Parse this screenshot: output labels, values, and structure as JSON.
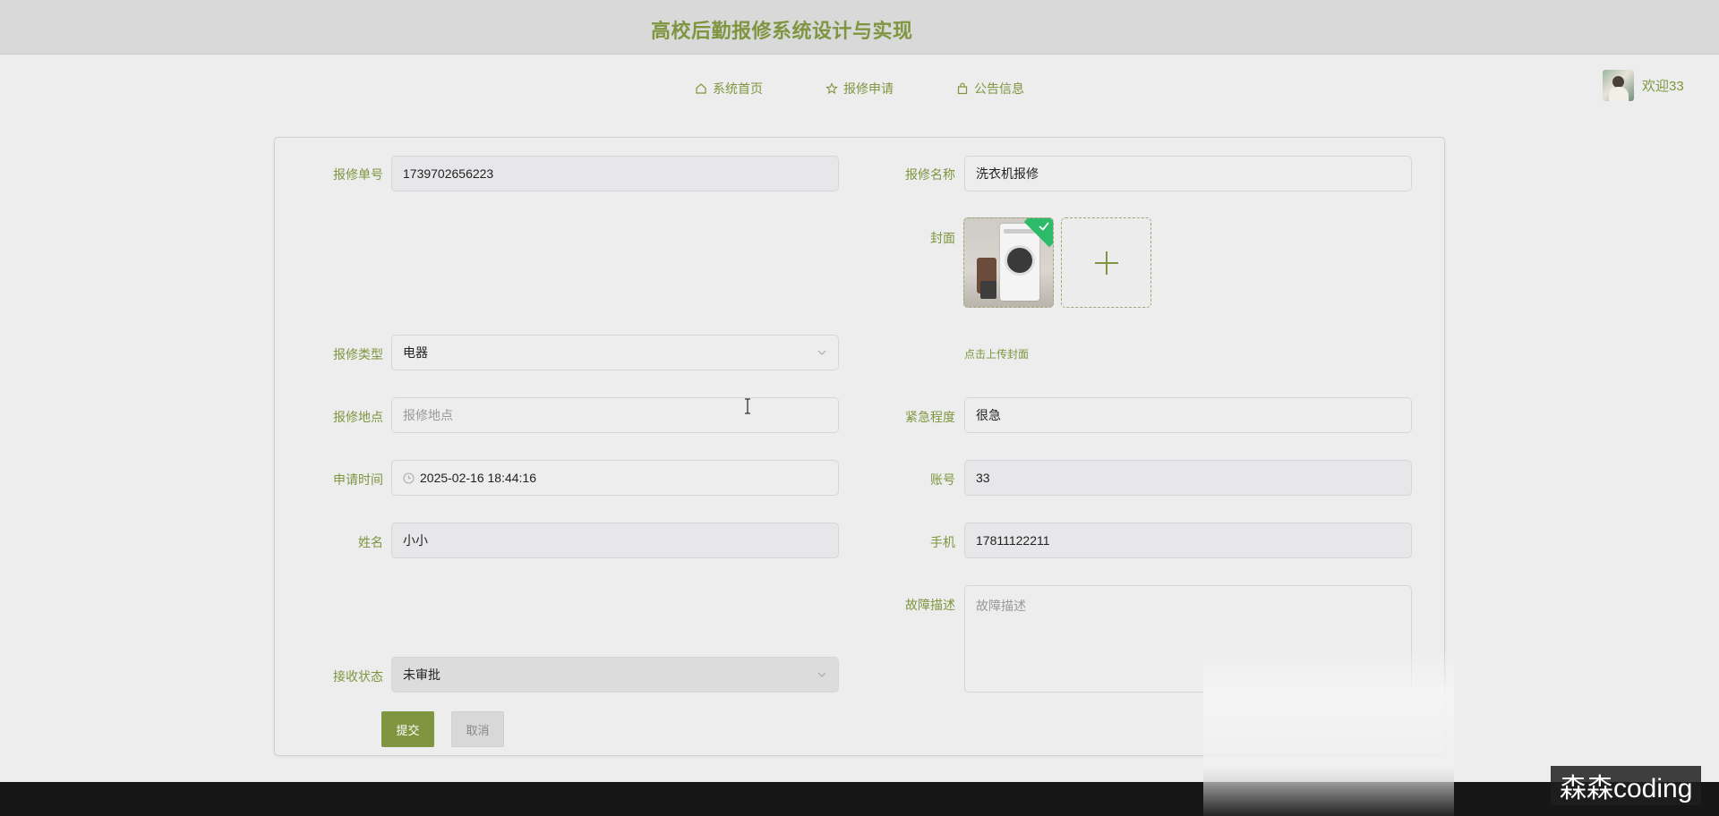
{
  "header": {
    "title": "高校后勤报修系统设计与实现"
  },
  "nav": {
    "items": [
      {
        "label": "系统首页",
        "icon": "home-icon"
      },
      {
        "label": "报修申请",
        "icon": "star-icon"
      },
      {
        "label": "公告信息",
        "icon": "bag-icon"
      }
    ]
  },
  "user": {
    "welcome": "欢迎33"
  },
  "form": {
    "order_no": {
      "label": "报修单号",
      "value": "1739702656223"
    },
    "repair_name": {
      "label": "报修名称",
      "value": "洗衣机报修"
    },
    "cover": {
      "label": "封面",
      "upload_hint": "点击上传封面"
    },
    "repair_type": {
      "label": "报修类型",
      "value": "电器"
    },
    "location": {
      "label": "报修地点",
      "placeholder": "报修地点"
    },
    "urgency": {
      "label": "紧急程度",
      "value": "很急"
    },
    "apply_time": {
      "label": "申请时间",
      "value": "2025-02-16 18:44:16"
    },
    "account": {
      "label": "账号",
      "value": "33"
    },
    "name": {
      "label": "姓名",
      "value": "小小"
    },
    "phone": {
      "label": "手机",
      "value": "17811122211"
    },
    "fault_desc": {
      "label": "故障描述",
      "placeholder": "故障描述"
    },
    "receive_status": {
      "label": "接收状态",
      "value": "未审批"
    },
    "submit_label": "提交",
    "cancel_label": "取消"
  },
  "watermark": "森森coding",
  "colors": {
    "accent": "#7f9540",
    "background": "#ededed",
    "topbar": "#d9d9d9"
  }
}
